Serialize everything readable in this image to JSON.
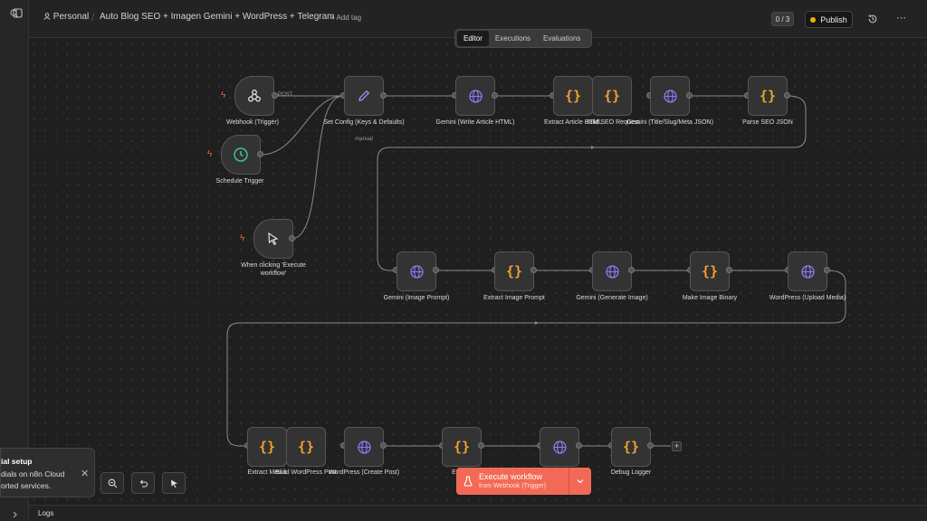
{
  "breadcrumb": {
    "project": "Personal",
    "workflow": "Auto Blog SEO + Imagen Gemini + WordPress + Telegram",
    "add_tag": "+ Add tag"
  },
  "header": {
    "counter": "0 / 3",
    "publish_label": "Publish",
    "status_color": "#f0b400"
  },
  "tabs": [
    {
      "label": "Editor",
      "active": true
    },
    {
      "label": "Executions"
    },
    {
      "label": "Evaluations"
    }
  ],
  "nodes": {
    "webhook": {
      "label": "Webhook (Trigger)",
      "icon": "webhook-icon",
      "method": "POST"
    },
    "schedule": {
      "label": "Schedule Trigger",
      "icon": "clock-icon"
    },
    "manual_trigger": {
      "label": "When clicking 'Execute workflow'",
      "icon": "cursor-icon"
    },
    "set_config": {
      "label": "Set Config (Keys & Defaults)",
      "sublabel": "manual",
      "icon": "pencil-icon"
    },
    "gemini_article": {
      "label": "Gemini (Write Article HTML)",
      "icon": "globe-icon"
    },
    "extract_article": {
      "label": "Extract Article HTML",
      "icon": "code-braces-icon"
    },
    "build_seo": {
      "label": "Build SEO Request",
      "icon": "code-braces-icon"
    },
    "gemini_title": {
      "label": "Gemini (Title/Slug/Meta JSON)",
      "icon": "globe-icon"
    },
    "parse_seo": {
      "label": "Parse SEO JSON",
      "icon": "code-braces-icon"
    },
    "gemini_image_prompt": {
      "label": "Gemini (Image Prompt)",
      "icon": "globe-icon"
    },
    "extract_image_prompt": {
      "label": "Extract Image Prompt",
      "icon": "code-braces-icon"
    },
    "gemini_generate_image": {
      "label": "Gemini (Generate Image)",
      "icon": "globe-icon"
    },
    "make_image_binary": {
      "label": "Make Image Binary",
      "icon": "code-braces-icon"
    },
    "wp_upload_media": {
      "label": "WordPress (Upload Media)",
      "icon": "globe-icon"
    },
    "extract_media": {
      "label": "Extract Media",
      "icon": "code-braces-icon"
    },
    "build_wp_post": {
      "label": "Build WordPress Post",
      "icon": "code-braces-icon"
    },
    "wp_create_post": {
      "label": "WordPress (Create Post)",
      "icon": "globe-icon"
    },
    "extract_post": {
      "label": "Extract",
      "icon": "code-braces-icon"
    },
    "telegram_send": {
      "icon": "globe-icon"
    },
    "debug_logger": {
      "label": "Debug Logger",
      "icon": "code-braces-icon"
    }
  },
  "toast": {
    "title": "ial setup",
    "line1": "dials on n8n Cloud",
    "line2": "orted services."
  },
  "execute": {
    "label": "Execute workflow",
    "sublabel": "from Webhook (Trigger)"
  },
  "logs_label": "Logs",
  "colors": {
    "accent": "#f26a57",
    "code_icon": "#f0a030",
    "globe_icon": "#8a7cf0",
    "clock_icon": "#3fc48a",
    "trigger_bolt": "#f2603a"
  }
}
